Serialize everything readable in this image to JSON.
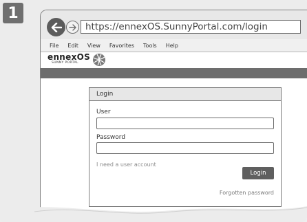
{
  "step": {
    "number": "1"
  },
  "browser": {
    "url": "https://ennexOS.SunnyPortal.com/login",
    "menu": [
      "File",
      "Edit",
      "View",
      "Favorites",
      "Tools",
      "Help"
    ]
  },
  "brand": {
    "name": "ennexOS",
    "sub": "SUNNY PORTAL"
  },
  "login": {
    "title": "Login",
    "user_label": "User",
    "user_value": "",
    "password_label": "Password",
    "password_value": "",
    "account_link": "I need a user account",
    "button": "Login",
    "forgot": "Forgotten password"
  },
  "colors": {
    "bar": "#6d6d6d",
    "button": "#5f5f5f",
    "badge": "#6f6f6f"
  }
}
